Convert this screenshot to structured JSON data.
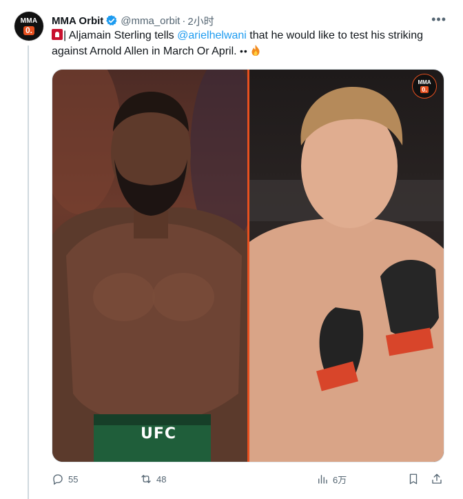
{
  "tweet": {
    "author_name": "MMA Orbit",
    "handle": "@mma_orbit",
    "separator": "·",
    "time": "2小时",
    "more_label": "•••",
    "avatar": {
      "top": "MMA",
      "bottom": "0."
    },
    "text": {
      "pre": "| Aljamain Sterling tells ",
      "mention": "@arielhelwani",
      "post": " that he would like to test his striking against Arnold Allen in March Or April. ",
      "eyes": "••"
    },
    "media": {
      "watermark": {
        "top": "MMA",
        "bottom": "0."
      },
      "trunks_text": "UFC"
    },
    "stats": {
      "replies": "55",
      "reposts": "48",
      "views": "6万"
    }
  },
  "colors": {
    "accent": "#1d9bf0",
    "brand_orange": "#e8501f",
    "muted": "#536471",
    "text": "#0f1419"
  },
  "icons": [
    "siren-icon",
    "fire-icon",
    "verified-icon",
    "reply-icon",
    "repost-icon",
    "views-icon",
    "bookmark-icon",
    "share-icon"
  ]
}
